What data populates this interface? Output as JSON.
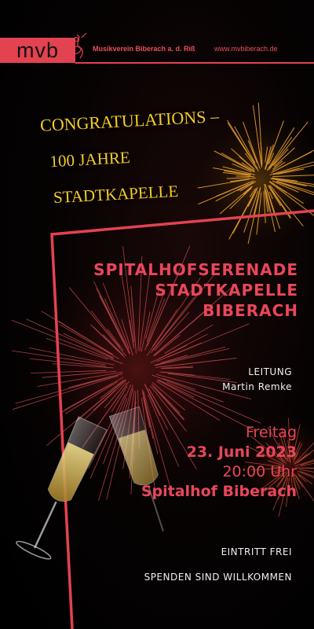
{
  "header": {
    "logo_text": "mvb",
    "org_name": "Musikverein Biberach a. d. Riß",
    "url": "www.mvbiberach.de"
  },
  "congrats": {
    "line1": "CONGRATULATIONS –",
    "line2": "100 JAHRE",
    "line3": "STADTKAPELLE"
  },
  "event": {
    "title_line1": "SPITALHOFSERENADE",
    "title_line2": "STADTKAPELLE",
    "title_line3": "BIBERACH",
    "leitung_label": "LEITUNG",
    "leitung_name": "Martin Remke",
    "day": "Freitag",
    "date": "23. Juni 2023",
    "time": "20:00 Uhr",
    "venue": "Spitalhof Biberach",
    "entry": "EINTRITT FREI",
    "donations": "SPENDEN SIND WILLKOMMEN"
  },
  "colors": {
    "accent": "#e34250",
    "gold": "#f2cc2a",
    "background": "#000000"
  }
}
